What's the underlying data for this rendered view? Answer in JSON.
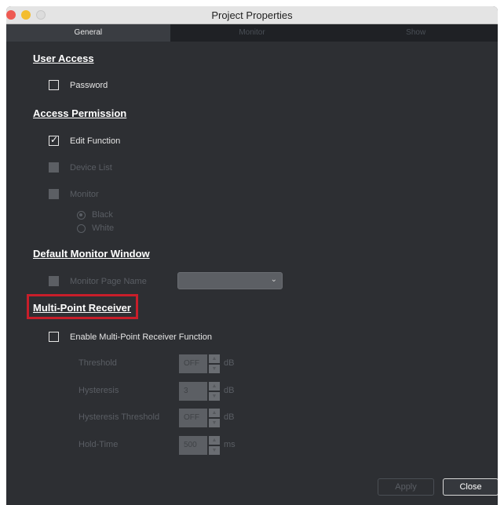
{
  "window": {
    "title": "Project Properties"
  },
  "tabs": [
    {
      "label": "General"
    },
    {
      "label": "Monitor"
    },
    {
      "label": "Show"
    }
  ],
  "user_access": {
    "heading": "User Access",
    "password_label": "Password",
    "password_checked": false
  },
  "access_permission": {
    "heading": "Access Permission",
    "edit_function_label": "Edit Function",
    "edit_function_checked": true,
    "device_list_label": "Device List",
    "monitor_label": "Monitor",
    "radio_black_label": "Black",
    "radio_white_label": "White",
    "selected_radio": "Black"
  },
  "default_monitor": {
    "heading": "Default Monitor Window",
    "monitor_page_name_label": "Monitor Page Name",
    "dropdown_value": ""
  },
  "multi_point": {
    "heading": "Multi-Point Receiver",
    "enable_label": "Enable Multi-Point Receiver Function",
    "enable_checked": false,
    "threshold_label": "Threshold",
    "threshold_value": "OFF",
    "threshold_unit": "dB",
    "hysteresis_label": "Hysteresis",
    "hysteresis_value": "3",
    "hysteresis_unit": "dB",
    "hyst_threshold_label": "Hysteresis Threshold",
    "hyst_threshold_value": "OFF",
    "hyst_threshold_unit": "dB",
    "hold_time_label": "Hold-Time",
    "hold_time_value": "500",
    "hold_time_unit": "ms"
  },
  "footer": {
    "apply_label": "Apply",
    "close_label": "Close"
  },
  "colors": {
    "highlight": "#c81e2a",
    "background": "#2d2f33"
  }
}
